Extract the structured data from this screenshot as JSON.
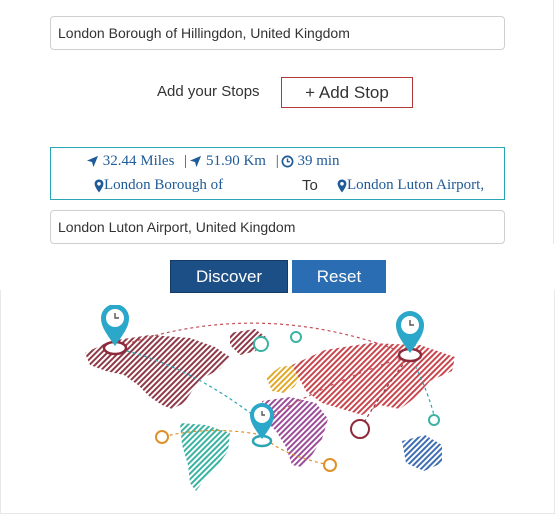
{
  "origin": {
    "value": "London Borough of Hillingdon, United Kingdom"
  },
  "stops": {
    "label": "Add your Stops",
    "button": "+ Add Stop"
  },
  "route": {
    "miles": "32.44 Miles",
    "km": "51.90 Km",
    "time": "39 min",
    "separator": "|",
    "from": "London Borough of",
    "to_word": "To",
    "to": "London Luton Airport,"
  },
  "destination": {
    "value": "London Luton Airport, United Kingdom"
  },
  "actions": {
    "discover": "Discover",
    "reset": "Reset"
  },
  "colors": {
    "accent": "#1d4f87",
    "route_text": "#1f5b97",
    "route_border": "#2aa5b3",
    "stop_border": "#b03a3a",
    "reset_bg": "#2b6db2"
  },
  "icons": [
    "navigation-arrow-icon",
    "clock-icon",
    "map-pin-icon",
    "map-pin-clock-icon"
  ]
}
